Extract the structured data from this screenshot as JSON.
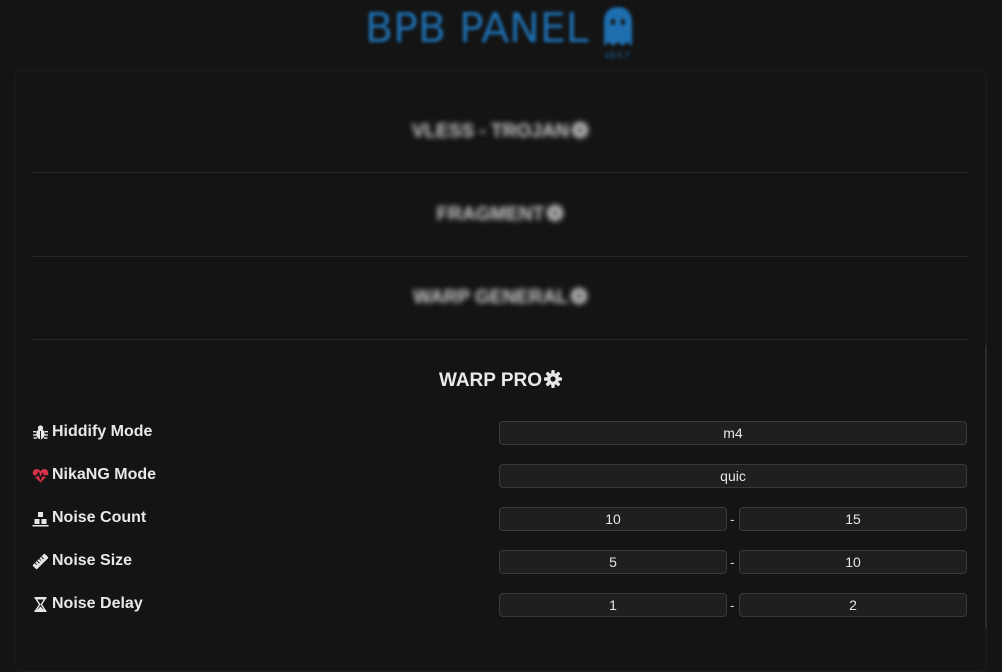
{
  "header": {
    "logo_text": "BPB PANEL",
    "version": "v3.0.7"
  },
  "sections": {
    "vless_trojan": "VLESS - TROJAN",
    "fragment": "FRAGMENT",
    "warp_general": "WARP GENERAL",
    "warp_pro": "WARP PRO"
  },
  "rows": {
    "hiddify_mode": {
      "label": "Hiddify Mode",
      "value": "m4"
    },
    "nikang_mode": {
      "label": "NikaNG Mode",
      "value": "quic"
    },
    "noise_count": {
      "label": "Noise Count",
      "min": "10",
      "max": "15"
    },
    "noise_size": {
      "label": "Noise Size",
      "min": "5",
      "max": "10"
    },
    "noise_delay": {
      "label": "Noise Delay",
      "min": "1",
      "max": "2"
    }
  },
  "range_separator": "-",
  "colors": {
    "background": "#141414",
    "logo_blue": "#1e6fb0",
    "heart_red": "#d6334a",
    "field_bg": "#1f1f1f"
  },
  "icons": {
    "bug": "bug-icon",
    "heart": "heartbeat-icon",
    "count": "cubes-icon",
    "size": "ruler-icon",
    "delay": "hourglass-icon",
    "gear": "gear-icon"
  }
}
